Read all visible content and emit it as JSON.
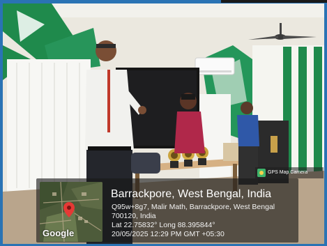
{
  "photo": {
    "description_icon": "scene-photo"
  },
  "camera_badge": {
    "icon": "gps-map-camera-icon",
    "label": "GPS Map Camera"
  },
  "geotag": {
    "map_brand": "Google",
    "pin_icon": "map-pin-icon",
    "title": "Barrackpore, West Bengal, India",
    "address_line1": "Q95w+8g7, Malir Math, Barrackpore, West Bengal",
    "address_line2": "700120, India",
    "coordinates": "Lat 22.75832° Long 88.395844°",
    "datetime": "20/05/2025 12:29 PM GMT +05:30"
  },
  "colors": {
    "wall_green": "#1f8a4c",
    "frame_blue": "#2a73b4",
    "overlay": "#191919",
    "pin_red": "#e53935"
  }
}
